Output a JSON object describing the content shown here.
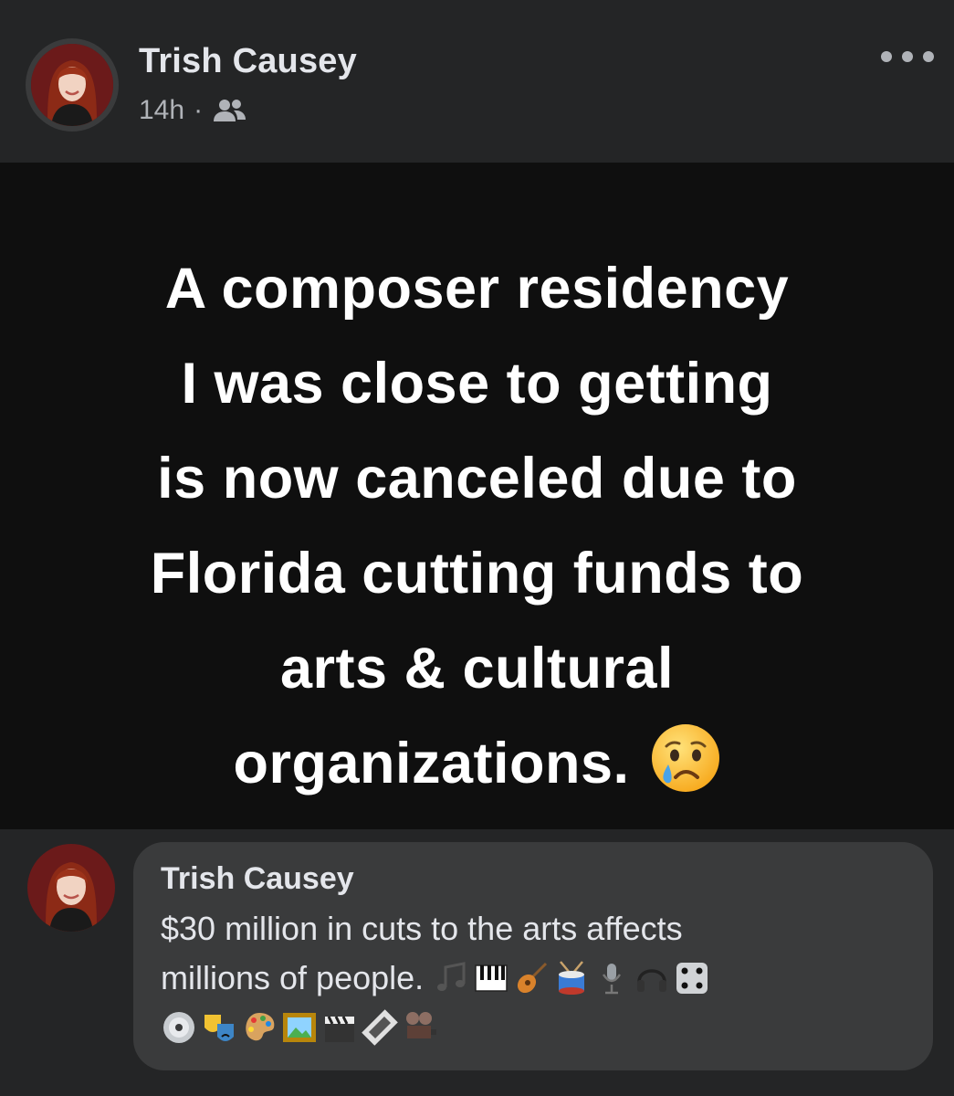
{
  "post": {
    "author": "Trish Causey",
    "time": "14h",
    "separator": "·",
    "audience_icon": "friends-icon",
    "more_icon": "more-dots-icon"
  },
  "card": {
    "lines": [
      "A composer residency",
      "I was close to getting",
      "is now canceled due to",
      "Florida cutting funds to",
      "arts & cultural",
      "organizations."
    ],
    "emoji": "crying-face-emoji",
    "background": "#0f0f0f",
    "text_color": "#ffffff"
  },
  "comment": {
    "author": "Trish Causey",
    "line1": "$30 million in cuts to the arts affects",
    "line2": "millions of people.",
    "emojis_line2": [
      "musical-notes-icon",
      "piano-keys-icon",
      "guitar-icon",
      "drum-icon",
      "microphone-icon",
      "headphones-icon",
      "dice-icon"
    ],
    "emojis_line3": [
      "dvd-icon",
      "theater-masks-icon",
      "palette-icon",
      "framed-picture-icon",
      "clapper-board-icon",
      "film-strip-icon",
      "film-projector-icon"
    ]
  },
  "colors": {
    "page_bg": "#242526",
    "bubble_bg": "#3a3b3c",
    "primary_text": "#e4e6eb",
    "secondary_text": "#b0b3b8"
  }
}
